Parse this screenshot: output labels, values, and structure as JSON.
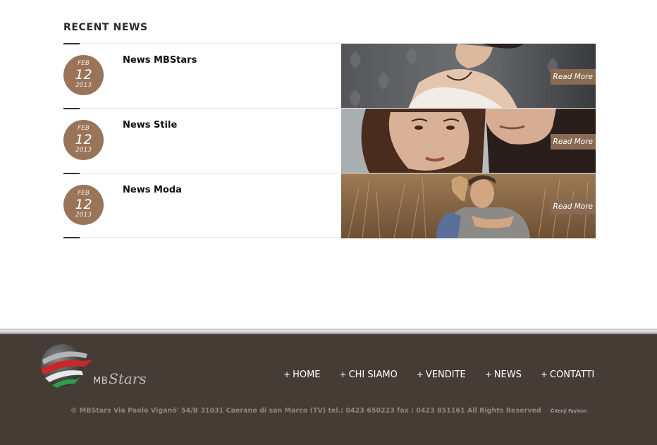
{
  "recent_news": {
    "title": "RECENT NEWS",
    "items": [
      {
        "month": "FEB",
        "day": "12",
        "year": "2013",
        "title": "News MBStars",
        "read_more": "Read More"
      },
      {
        "month": "FEB",
        "day": "12",
        "year": "2013",
        "title": "News Stile",
        "read_more": "Read More"
      },
      {
        "month": "FEB",
        "day": "12",
        "year": "2013",
        "title": "News Moda",
        "read_more": "Read More"
      }
    ]
  },
  "footer": {
    "logo": {
      "mb": "MB",
      "stars": "Stars"
    },
    "nav": [
      {
        "plus": "+",
        "label": "HOME"
      },
      {
        "plus": "+",
        "label": "CHI SIAMO"
      },
      {
        "plus": "+",
        "label": "VENDITE"
      },
      {
        "plus": "+",
        "label": "NEWS"
      },
      {
        "plus": "+",
        "label": "CONTATTI"
      }
    ],
    "copyright": "© MBStars Via Paolo Viganò' 54/B 31031 Caerano di san Marco (TV) tel.: 0423 650223 fax : 0423 851161 All Rights Reserved",
    "credit": "©Kenji Fashion"
  },
  "colors": {
    "badge": "#9a7459",
    "read_more_bg": "#8a6a53",
    "footer_bg": "#453c36"
  }
}
